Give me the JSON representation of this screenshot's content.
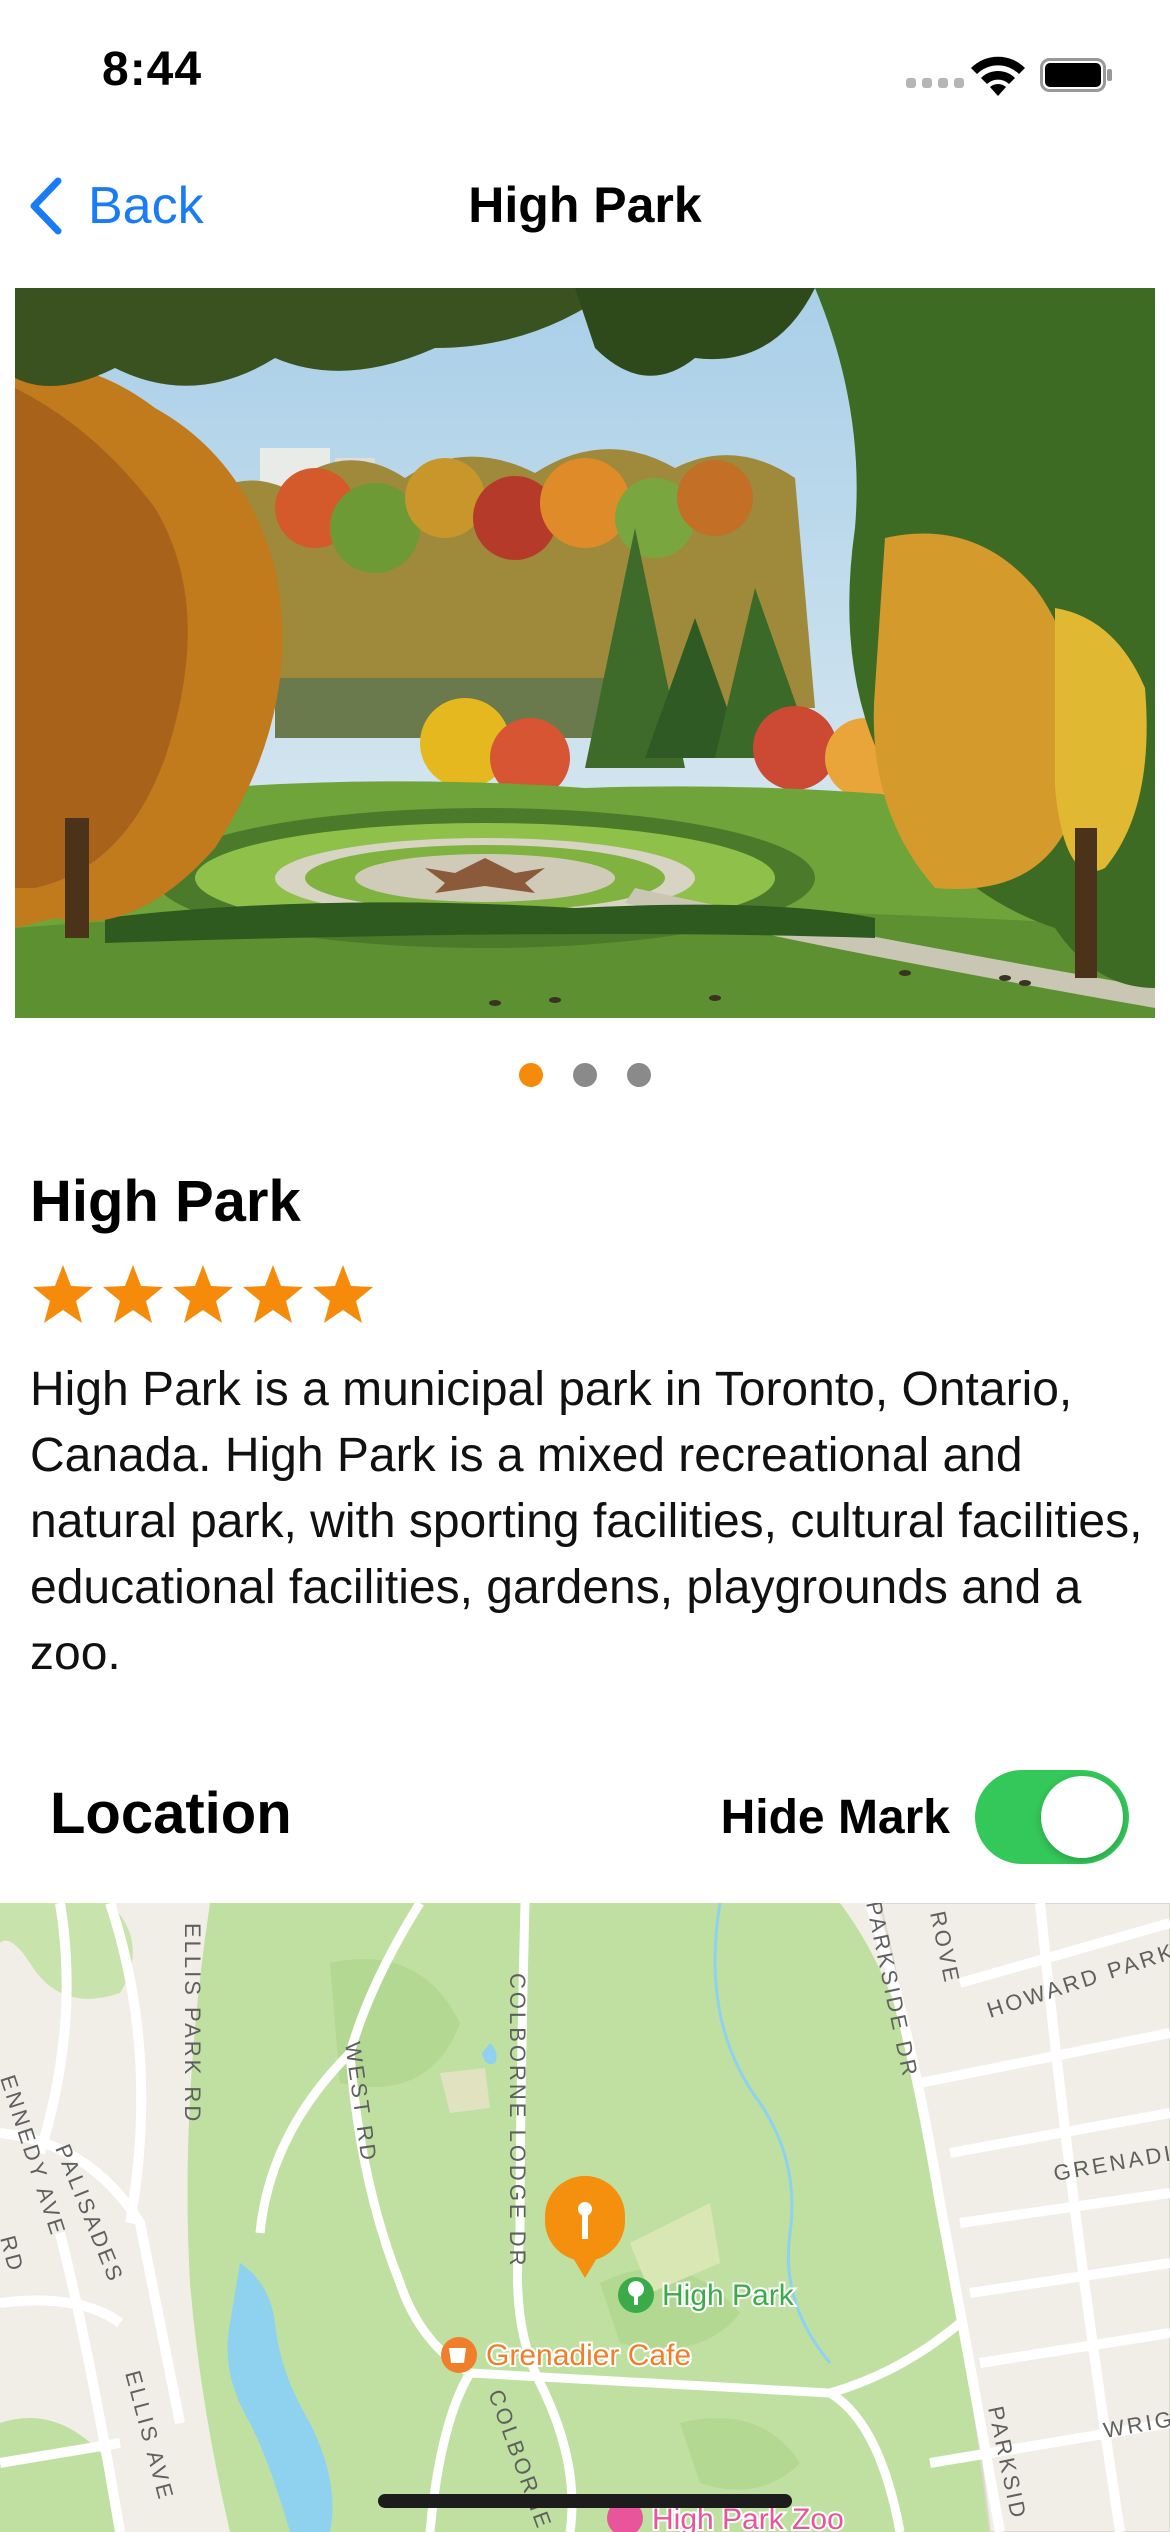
{
  "status_bar": {
    "time": "8:44"
  },
  "nav": {
    "back_label": "Back",
    "title": "High Park"
  },
  "gallery": {
    "image_count": 3,
    "active_index": 0
  },
  "park": {
    "name": "High Park",
    "rating": 5,
    "description": "High Park is a municipal park in Toronto, Ontario, Canada. High Park is a mixed recreational and natural park, with sporting facilities, cultural facilities, educational facilities, gardens, playgrounds and a zoo."
  },
  "location": {
    "heading": "Location",
    "toggle_label": "Hide Mark",
    "toggle_on": true
  },
  "map": {
    "street_labels": {
      "ellis_park_rd": "ELLIS PARK RD",
      "colborne_lodge_dr": "COLBORNE LODGE DR",
      "parkside_dr": "PARKSIDE DR",
      "grove": "ROVE",
      "howard_park": "HOWARD PARK",
      "west_rd": "WEST RD",
      "kennedy_ave": "ENNEDY AVE",
      "palisades": "PALISADES",
      "grenadier": "GRENADIE",
      "rd_left": "RD",
      "ellis_ave": "ELLIS AVE",
      "colborne_lower": "COLBORNE L",
      "parkside_lower": "PARKSID",
      "wrig": "WRIG"
    },
    "pois": {
      "high_park": "High Park",
      "grenadier_cafe": "Grenadier Cafe",
      "high_park_zoo": "High Park Zoo"
    },
    "colors": {
      "park_green": "#bfe0a0",
      "poi_green": "#3aab48",
      "poi_orange": "#f07e2a",
      "poi_pink": "#e8559b",
      "pin_orange": "#f5900f",
      "water": "#8fd2f0"
    }
  }
}
